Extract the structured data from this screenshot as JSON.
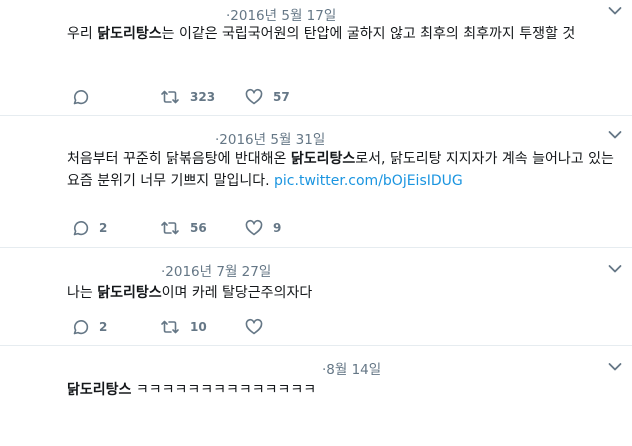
{
  "tweets": [
    {
      "date": "·2016년 5월 17일",
      "text_before": "우리 ",
      "bold": "닭도리탕스",
      "text_after": "는 이같은 국립국어원의 탄압에 굴하지 않고 최후의 최후까지 투쟁할 것",
      "link": "",
      "reply_count": "",
      "retweet_count": "323",
      "like_count": "57"
    },
    {
      "date": "·2016년 5월 31일",
      "text_before": "처음부터 꾸준히 닭볶음탕에 반대해온 ",
      "bold": "닭도리탕스",
      "text_after": "로서, 닭도리탕 지지자가 계속 늘어나고 있는 요즘 분위기 너무 기쁘지 말입니다. ",
      "link": "pic.twitter.com/bOjEisIDUG",
      "reply_count": "2",
      "retweet_count": "56",
      "like_count": "9"
    },
    {
      "date": "·2016년 7월 27일",
      "text_before": "나는 ",
      "bold": "닭도리탕스",
      "text_after": "이며 카레 탈당근주의자다",
      "link": "",
      "reply_count": "2",
      "retweet_count": "10",
      "like_count": ""
    },
    {
      "date": "·8월 14일",
      "text_before": "",
      "bold": "닭도리탕스",
      "text_after": " ㅋㅋㅋㅋㅋㅋㅋㅋㅋㅋㅋㅋㅋㅋ",
      "link": "",
      "reply_count": "",
      "retweet_count": "",
      "like_count": ""
    }
  ],
  "icons": {
    "reply": "reply-icon",
    "retweet": "retweet-icon",
    "like": "heart-icon",
    "caret": "chevron-down-icon"
  },
  "colors": {
    "text": "#14171a",
    "muted": "#657786",
    "link": "#1b95e0",
    "divider": "#e6ecf0"
  }
}
